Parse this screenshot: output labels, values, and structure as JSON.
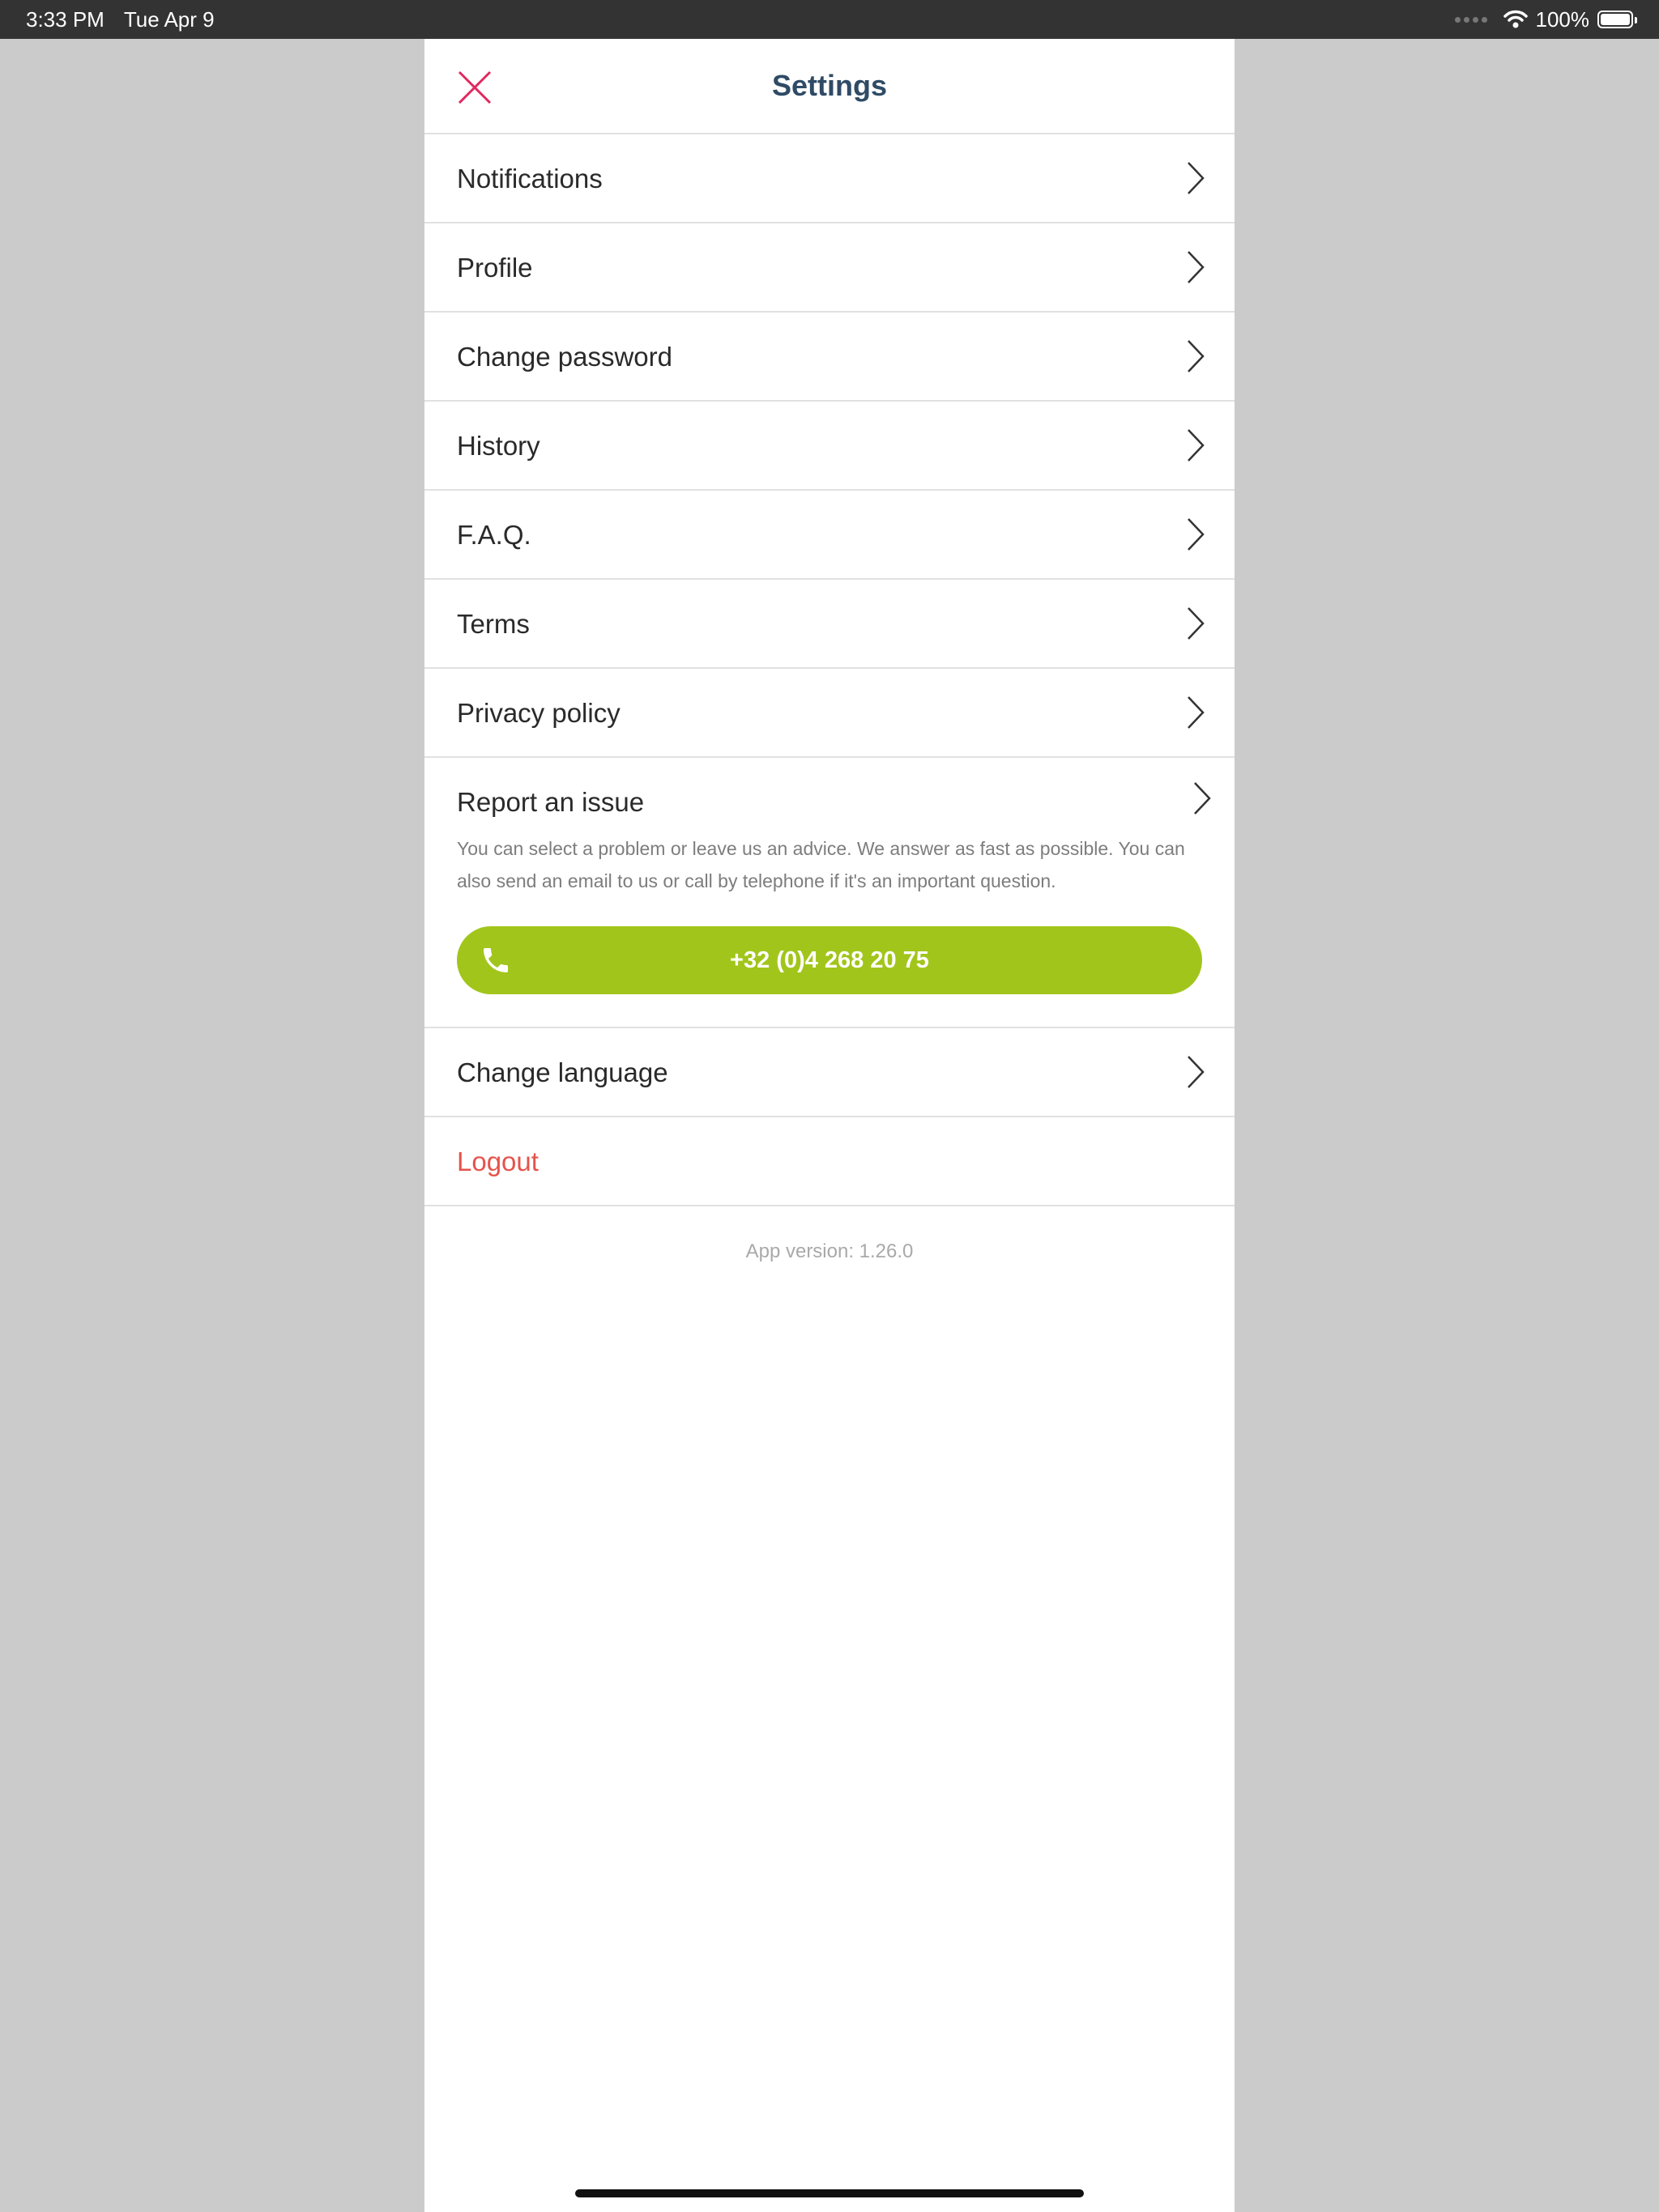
{
  "status_bar": {
    "time": "3:33 PM",
    "date": "Tue Apr 9",
    "battery_percent": "100%",
    "battery_level": 1.0,
    "icons": [
      "signal-dots-icon",
      "wifi-icon",
      "battery-icon"
    ]
  },
  "header": {
    "title": "Settings",
    "close_icon": "close-icon"
  },
  "menu": {
    "notifications": "Notifications",
    "profile": "Profile",
    "change_password": "Change password",
    "history": "History",
    "faq": "F.A.Q.",
    "terms": "Terms",
    "privacy_policy": "Privacy policy",
    "change_language": "Change language",
    "logout": "Logout"
  },
  "report": {
    "label": "Report an issue",
    "description": "You can select a problem or leave us an advice. We answer as fast as possible. You can also send an email to us or call by telephone if it's an important question.",
    "phone_button": "+32 (0)4 268 20 75",
    "phone_icon": "phone-icon"
  },
  "footer": {
    "app_version": "App version: 1.26.0"
  },
  "colors": {
    "close_icon": "#e0285f",
    "title": "#2f4b66",
    "phone_button": "#a2c51b",
    "logout": "#e5534b",
    "overlay_background": "#cbcbcb",
    "status_bar": "#333333"
  }
}
